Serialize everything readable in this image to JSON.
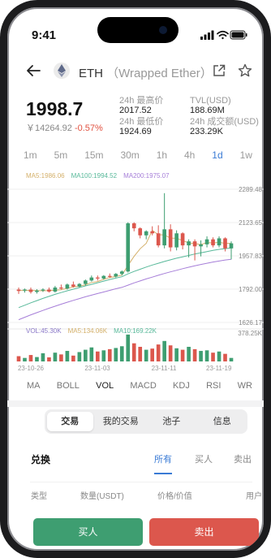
{
  "status_bar": {
    "time": "9:41"
  },
  "header": {
    "symbol": "ETH",
    "full_name": "（Wrapped Ether）"
  },
  "price": {
    "main": "1998.7",
    "cny": "￥14264.92",
    "change": "-0.57%",
    "change_color": "#e15241"
  },
  "stats": [
    {
      "label": "24h 最高价",
      "value": "2017.52"
    },
    {
      "label": "24h 最低价",
      "value": "1924.69"
    },
    {
      "label": "TVL(USD)",
      "value": "188.69M"
    },
    {
      "label": "24h 成交额(USD)",
      "value": "233.29K"
    }
  ],
  "intervals": [
    "1m",
    "5m",
    "15m",
    "30m",
    "1h",
    "4h",
    "1d",
    "1w"
  ],
  "active_interval": "1d",
  "ma_legend": [
    {
      "label": "MA5:1986.06",
      "color": "#d4b06a"
    },
    {
      "label": "MA100:1994.52",
      "color": "#58b99a"
    },
    {
      "label": "MA200:1975.07",
      "color": "#a67ed8"
    }
  ],
  "vol_legend": [
    {
      "label": "VOL:45.30K",
      "color": "#8a78c8"
    },
    {
      "label": "MA5:134.06K",
      "color": "#d4b06a"
    },
    {
      "label": "MA10:169.22K",
      "color": "#58b99a"
    }
  ],
  "chart_data": {
    "type": "candlestick",
    "y_ticks": [
      "2289.48",
      "2123.65",
      "1957.83",
      "1792.00",
      "1626.17"
    ],
    "vol_ticks": [
      "378.25K"
    ],
    "ylim": [
      1626.17,
      2289.48
    ],
    "x_ticks": [
      "23-10-26",
      "23-11-03",
      "23-11-11",
      "23-11-19"
    ],
    "candles": [
      {
        "o": 1790,
        "h": 1800,
        "l": 1768,
        "c": 1783
      },
      {
        "o": 1785,
        "h": 1795,
        "l": 1775,
        "c": 1790
      },
      {
        "o": 1790,
        "h": 1800,
        "l": 1770,
        "c": 1778
      },
      {
        "o": 1778,
        "h": 1792,
        "l": 1770,
        "c": 1785
      },
      {
        "o": 1785,
        "h": 1796,
        "l": 1778,
        "c": 1790
      },
      {
        "o": 1790,
        "h": 1800,
        "l": 1775,
        "c": 1780
      },
      {
        "o": 1780,
        "h": 1808,
        "l": 1775,
        "c": 1800
      },
      {
        "o": 1800,
        "h": 1815,
        "l": 1790,
        "c": 1795
      },
      {
        "o": 1795,
        "h": 1820,
        "l": 1790,
        "c": 1815
      },
      {
        "o": 1815,
        "h": 1830,
        "l": 1800,
        "c": 1805
      },
      {
        "o": 1805,
        "h": 1822,
        "l": 1800,
        "c": 1818
      },
      {
        "o": 1818,
        "h": 1840,
        "l": 1810,
        "c": 1835
      },
      {
        "o": 1835,
        "h": 1860,
        "l": 1830,
        "c": 1850
      },
      {
        "o": 1850,
        "h": 1860,
        "l": 1835,
        "c": 1845
      },
      {
        "o": 1845,
        "h": 1862,
        "l": 1840,
        "c": 1858
      },
      {
        "o": 1858,
        "h": 1870,
        "l": 1848,
        "c": 1855
      },
      {
        "o": 1855,
        "h": 1872,
        "l": 1850,
        "c": 1868
      },
      {
        "o": 1868,
        "h": 1885,
        "l": 1860,
        "c": 1880
      },
      {
        "o": 1880,
        "h": 2125,
        "l": 1875,
        "c": 2120
      },
      {
        "o": 2120,
        "h": 2125,
        "l": 2080,
        "c": 2095
      },
      {
        "o": 2095,
        "h": 2100,
        "l": 2045,
        "c": 2060
      },
      {
        "o": 2060,
        "h": 2085,
        "l": 2040,
        "c": 2080
      },
      {
        "o": 2080,
        "h": 2105,
        "l": 2060,
        "c": 2070
      },
      {
        "o": 2070,
        "h": 2110,
        "l": 2000,
        "c": 2010
      },
      {
        "o": 2010,
        "h": 2270,
        "l": 1995,
        "c": 2090
      },
      {
        "o": 2090,
        "h": 2115,
        "l": 1980,
        "c": 2000
      },
      {
        "o": 2000,
        "h": 2085,
        "l": 1985,
        "c": 2070
      },
      {
        "o": 2070,
        "h": 2075,
        "l": 1990,
        "c": 2010
      },
      {
        "o": 2010,
        "h": 2040,
        "l": 1950,
        "c": 2030
      },
      {
        "o": 2030,
        "h": 2040,
        "l": 1935,
        "c": 2005
      },
      {
        "o": 2005,
        "h": 2035,
        "l": 1955,
        "c": 2015
      },
      {
        "o": 2015,
        "h": 2055,
        "l": 2000,
        "c": 2040
      },
      {
        "o": 2040,
        "h": 2050,
        "l": 2000,
        "c": 2010
      },
      {
        "o": 2010,
        "h": 2055,
        "l": 2000,
        "c": 2045
      },
      {
        "o": 2045,
        "h": 2050,
        "l": 1980,
        "c": 1995
      },
      {
        "o": 1995,
        "h": 2030,
        "l": 1940,
        "c": 2020
      }
    ],
    "ma_lines": [
      {
        "name": "MA5",
        "color": "#d4b06a",
        "values": [
          1785,
          1786,
          1786,
          1785,
          1784,
          1785,
          1787,
          1789,
          1796,
          1803,
          1807,
          1814,
          1825,
          1830,
          1841,
          1850,
          1855,
          1862,
          1910,
          1955,
          1993,
          2020,
          2085,
          2063,
          2062,
          2046,
          2046,
          2034,
          2022,
          2019,
          2014,
          2024,
          2022,
          2025,
          2020,
          2020
        ]
      },
      {
        "name": "MA100",
        "color": "#58b99a",
        "values": [
          1700,
          1712,
          1724,
          1735,
          1746,
          1756,
          1766,
          1775,
          1784,
          1792,
          1800,
          1808,
          1816,
          1824,
          1832,
          1840,
          1847,
          1854,
          1868,
          1880,
          1891,
          1902,
          1912,
          1921,
          1930,
          1938,
          1946,
          1953,
          1960,
          1967,
          1973,
          1979,
          1985,
          1990,
          1994,
          1997
        ]
      },
      {
        "name": "MA200",
        "color": "#a67ed8",
        "values": [
          1640,
          1652,
          1664,
          1675,
          1686,
          1697,
          1707,
          1717,
          1727,
          1736,
          1745,
          1754,
          1762,
          1770,
          1778,
          1786,
          1794,
          1801,
          1812,
          1823,
          1833,
          1843,
          1852,
          1861,
          1870,
          1878,
          1886,
          1894,
          1901,
          1908,
          1915,
          1921,
          1927,
          1932,
          1937,
          1941
        ]
      }
    ],
    "volume_max": 378250,
    "volumes": [
      0.18,
      0.12,
      0.22,
      0.15,
      0.28,
      0.14,
      0.3,
      0.24,
      0.36,
      0.2,
      0.32,
      0.4,
      0.48,
      0.34,
      0.38,
      0.42,
      0.46,
      0.52,
      0.92,
      0.62,
      0.5,
      0.4,
      0.44,
      0.58,
      0.7,
      0.55,
      0.45,
      0.4,
      0.5,
      0.42,
      0.36,
      0.38,
      0.3,
      0.34,
      0.26,
      0.12
    ]
  },
  "indicators": [
    "MA",
    "BOLL",
    "VOL",
    "MACD",
    "KDJ",
    "RSI",
    "WR"
  ],
  "active_indicator": "VOL",
  "segments": [
    "交易",
    "我的交易",
    "池子",
    "信息"
  ],
  "active_segment": "交易",
  "swap": {
    "title": "兑换",
    "tabs": [
      "所有",
      "买人",
      "卖出"
    ],
    "columns": [
      "类型",
      "数量(USDT)",
      "价格/价值",
      "用户"
    ]
  },
  "buttons": {
    "buy": "买人",
    "sell": "卖出"
  },
  "colors": {
    "up": "#3e9e71",
    "down": "#dc574d",
    "accent": "#3a7bd5"
  }
}
